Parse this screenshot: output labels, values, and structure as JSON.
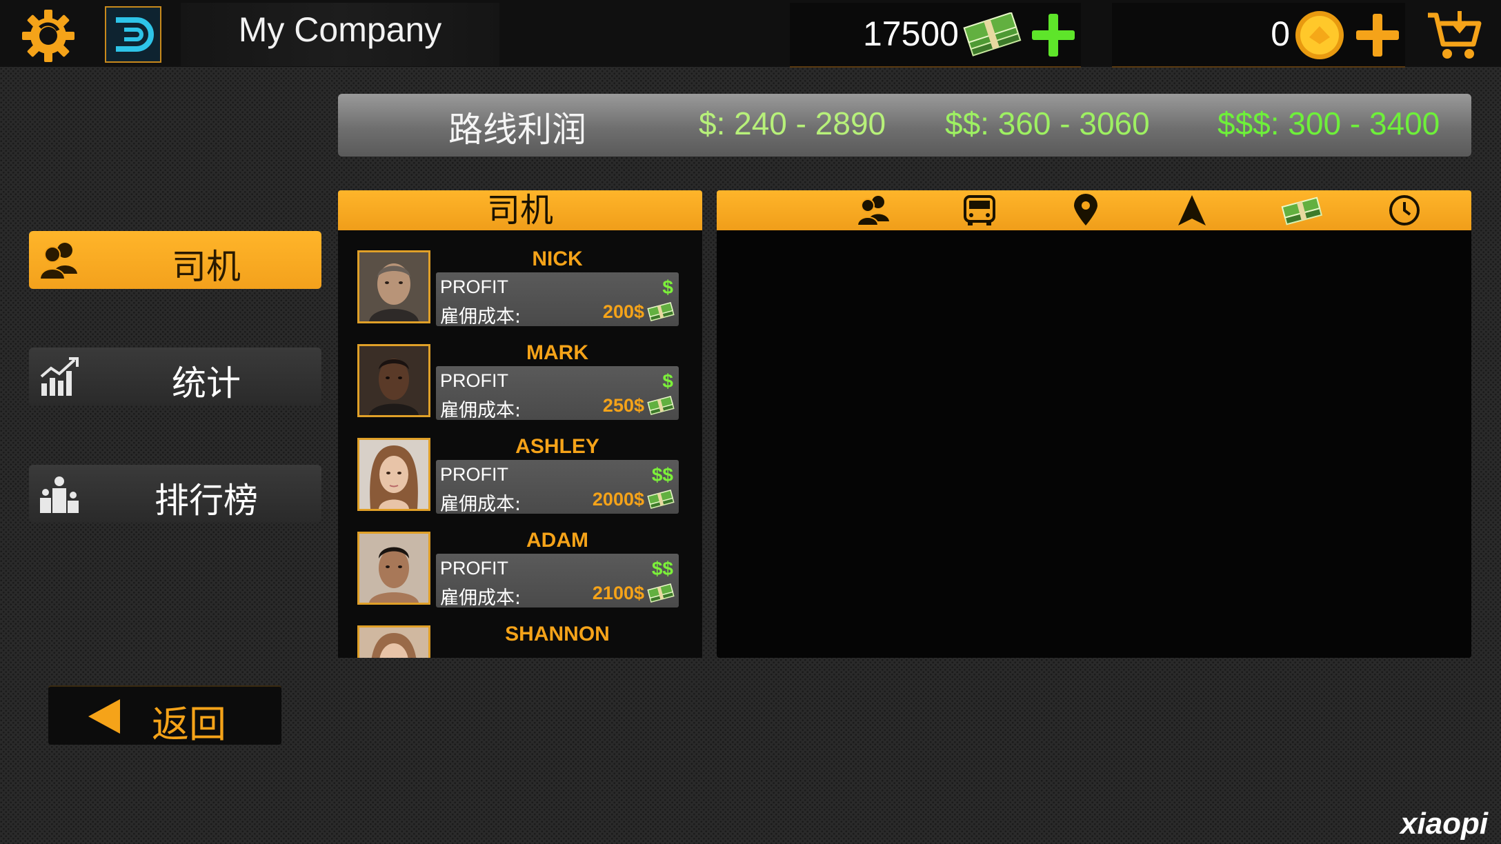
{
  "topbar": {
    "company_name": "My Company",
    "money": "17500",
    "coins": "0"
  },
  "route_profit": {
    "title": "路线利润",
    "ranges": [
      "$: 240 - 2890",
      "$$: 360 - 3060",
      "$$$: 300 - 3400"
    ]
  },
  "menu": {
    "items": [
      {
        "label": "司机",
        "icon": "drivers-icon",
        "active": true
      },
      {
        "label": "统计",
        "icon": "stats-chart-icon",
        "active": false
      },
      {
        "label": "排行榜",
        "icon": "leaderboard-icon",
        "active": false
      }
    ],
    "back_label": "返回"
  },
  "drivers": {
    "header": "司机",
    "list": [
      {
        "name": "NICK",
        "profit_label": "PROFIT",
        "profit": "$",
        "cost_label": "雇佣成本:",
        "cost": "200$"
      },
      {
        "name": "MARK",
        "profit_label": "PROFIT",
        "profit": "$",
        "cost_label": "雇佣成本:",
        "cost": "250$"
      },
      {
        "name": "ASHLEY",
        "profit_label": "PROFIT",
        "profit": "$$",
        "cost_label": "雇佣成本:",
        "cost": "2000$"
      },
      {
        "name": "ADAM",
        "profit_label": "PROFIT",
        "profit": "$$",
        "cost_label": "雇佣成本:",
        "cost": "2100$"
      },
      {
        "name": "SHANNON"
      }
    ]
  },
  "assignment_header_icons": [
    "drivers-icon",
    "bus-icon",
    "location-pin-icon",
    "navigation-arrow-icon",
    "cash-icon",
    "clock-icon"
  ],
  "watermark": "xiaopi",
  "colors": {
    "accent": "#f5a319",
    "profit_green": "#7cf03a",
    "background": "#2a2a2a"
  }
}
